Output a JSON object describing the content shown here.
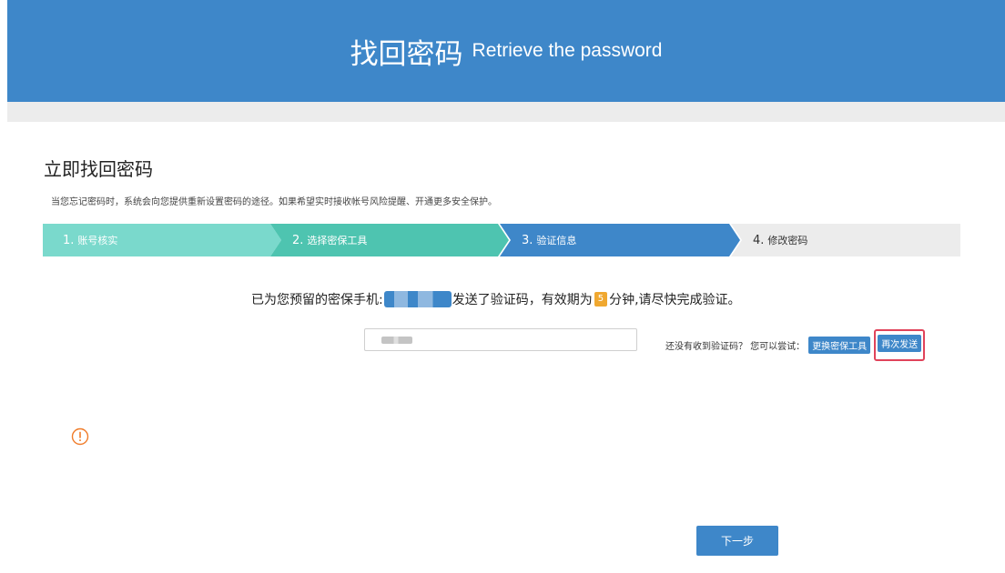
{
  "header": {
    "title_zh": "找回密码",
    "title_en": "Retrieve the password"
  },
  "page": {
    "title": "立即找回密码",
    "intro": "当您忘记密码时，系统会向您提供重新设置密码的途径。如果希望实时接收帐号风险提醒、开通更多安全保护。"
  },
  "steps": [
    {
      "num": "1.",
      "label": "账号核实",
      "state": "done"
    },
    {
      "num": "2.",
      "label": "选择密保工具",
      "state": "done"
    },
    {
      "num": "3.",
      "label": "验证信息",
      "state": "active"
    },
    {
      "num": "4.",
      "label": "修改密码",
      "state": "pending"
    }
  ],
  "verify": {
    "msg_prefix": "已为您预留的密保手机:",
    "msg_middle": "发送了验证码，有效期为",
    "minutes": "5",
    "msg_suffix": "分钟,请尽快完成验证。",
    "not_received": "还没有收到验证码？ 您可以尝试：",
    "change_tool": "更换密保工具",
    "resend": "再次发送"
  },
  "actions": {
    "next": "下一步"
  },
  "colors": {
    "primary": "#3e87c9",
    "step_done_1": "#7ad9cc",
    "step_done_2": "#4ec4b0",
    "warning": "#f07c2a",
    "badge": "#f0a830",
    "highlight": "#e0435a"
  },
  "icons": {
    "warning": "warning-circle-icon"
  }
}
